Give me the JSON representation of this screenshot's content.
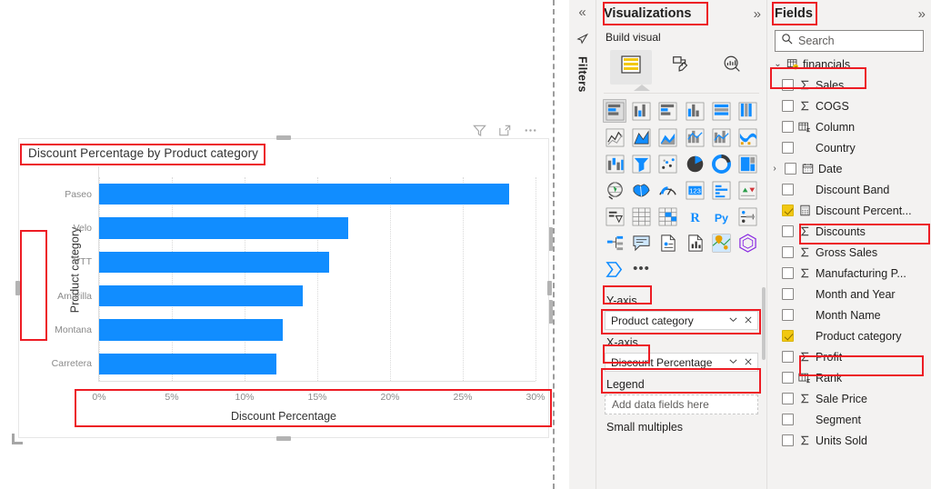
{
  "canvas": {
    "visual_title": "Discount Percentage by Product category",
    "header_icons": [
      {
        "name": "filter-icon",
        "label": "Filters"
      },
      {
        "name": "focus-mode-icon",
        "label": "Focus mode"
      },
      {
        "name": "more-options-icon",
        "label": "More options"
      }
    ]
  },
  "chart_data": {
    "type": "bar",
    "orientation": "horizontal",
    "title": "Discount Percentage by Product category",
    "xlabel": "Discount Percentage",
    "ylabel": "Product category",
    "categories": [
      "Paseo",
      "Velo",
      "VTT",
      "Amarilla",
      "Montana",
      "Carretera"
    ],
    "values": [
      28.2,
      17.1,
      15.8,
      14.0,
      12.6,
      12.2
    ],
    "value_format": "percent",
    "xlim": [
      0,
      30
    ],
    "xticks": [
      0,
      5,
      10,
      15,
      20,
      25,
      30
    ],
    "xtick_labels": [
      "0%",
      "5%",
      "10%",
      "15%",
      "20%",
      "25%",
      "30%"
    ],
    "grid": true,
    "legend": false,
    "series_color": "#118DFF"
  },
  "filters_rail": {
    "collapse_chevron": "«",
    "icon": "filter-funnel-icon",
    "label": "Filters"
  },
  "visualizations": {
    "title": "Visualizations",
    "expand_chevron": "»",
    "build_visual_label": "Build visual",
    "tabs": [
      {
        "name": "build-visual-tab",
        "icon": "fields-build-icon",
        "active": true
      },
      {
        "name": "format-visual-tab",
        "icon": "paint-roller-icon",
        "active": false
      },
      {
        "name": "analytics-tab",
        "icon": "magnifier-chart-icon",
        "active": false
      }
    ],
    "visual_types": [
      {
        "name": "stacked-bar-chart",
        "selected": true
      },
      {
        "name": "stacked-column-chart",
        "selected": false
      },
      {
        "name": "clustered-bar-chart",
        "selected": false
      },
      {
        "name": "clustered-column-chart",
        "selected": false
      },
      {
        "name": "100-stacked-bar-chart",
        "selected": false
      },
      {
        "name": "100-stacked-column-chart",
        "selected": false
      },
      {
        "name": "line-chart",
        "selected": false
      },
      {
        "name": "area-chart",
        "selected": false
      },
      {
        "name": "stacked-area-chart",
        "selected": false
      },
      {
        "name": "line-and-stacked-column-chart",
        "selected": false
      },
      {
        "name": "line-and-clustered-column-chart",
        "selected": false
      },
      {
        "name": "ribbon-chart",
        "selected": false
      },
      {
        "name": "waterfall-chart",
        "selected": false
      },
      {
        "name": "funnel-chart",
        "selected": false
      },
      {
        "name": "scatter-chart",
        "selected": false
      },
      {
        "name": "pie-chart",
        "selected": false
      },
      {
        "name": "donut-chart",
        "selected": false
      },
      {
        "name": "treemap",
        "selected": false
      },
      {
        "name": "map",
        "selected": false
      },
      {
        "name": "filled-map",
        "selected": false
      },
      {
        "name": "gauge",
        "selected": false
      },
      {
        "name": "card",
        "selected": false
      },
      {
        "name": "multi-row-card",
        "selected": false
      },
      {
        "name": "kpi",
        "selected": false
      },
      {
        "name": "slicer",
        "selected": false
      },
      {
        "name": "table",
        "selected": false
      },
      {
        "name": "matrix",
        "selected": false
      },
      {
        "name": "r-script-visual",
        "selected": false
      },
      {
        "name": "python-visual",
        "selected": false
      },
      {
        "name": "key-influencers",
        "selected": false
      },
      {
        "name": "decomposition-tree",
        "selected": false
      },
      {
        "name": "q-and-a",
        "selected": false
      },
      {
        "name": "smart-narrative",
        "selected": false
      },
      {
        "name": "paginated-report",
        "selected": false
      },
      {
        "name": "azure-map",
        "selected": false
      },
      {
        "name": "power-apps",
        "selected": false
      },
      {
        "name": "power-automate",
        "selected": false
      },
      {
        "name": "more-visuals",
        "selected": false
      }
    ],
    "wells": [
      {
        "label": "Y-axis",
        "field": "Product category",
        "placeholder": null
      },
      {
        "label": "X-axis",
        "field": "Discount Percentage",
        "placeholder": null
      },
      {
        "label": "Legend",
        "field": null,
        "placeholder": "Add data fields here"
      },
      {
        "label": "Small multiples",
        "field": null,
        "placeholder": null
      }
    ],
    "chip_dropdown_icon": "chevron-down-icon",
    "chip_remove_icon": "close-icon"
  },
  "fields": {
    "title": "Fields",
    "expand_chevron": "»",
    "search_placeholder": "Search",
    "search_value": "",
    "search_icon": "search-icon",
    "table": {
      "name": "financials",
      "expanded": true,
      "caret": "⌄",
      "icon": "table-warning-icon"
    },
    "items": [
      {
        "label": "Sales",
        "icon": "sigma-icon",
        "checked": false,
        "expandable": false
      },
      {
        "label": "COGS",
        "icon": "sigma-icon",
        "checked": false,
        "expandable": false
      },
      {
        "label": "Column",
        "icon": "calculated-column-icon",
        "checked": false,
        "expandable": false
      },
      {
        "label": "Country",
        "icon": "none",
        "checked": false,
        "expandable": false
      },
      {
        "label": "Date",
        "icon": "calendar-icon",
        "checked": false,
        "expandable": true
      },
      {
        "label": "Discount Band",
        "icon": "none",
        "checked": false,
        "expandable": false
      },
      {
        "label": "Discount Percent...",
        "icon": "measure-icon",
        "checked": true,
        "expandable": false
      },
      {
        "label": "Discounts",
        "icon": "sigma-icon",
        "checked": false,
        "expandable": false
      },
      {
        "label": "Gross Sales",
        "icon": "sigma-icon",
        "checked": false,
        "expandable": false
      },
      {
        "label": "Manufacturing P...",
        "icon": "sigma-icon",
        "checked": false,
        "expandable": false
      },
      {
        "label": "Month and Year",
        "icon": "none",
        "checked": false,
        "expandable": false
      },
      {
        "label": "Month Name",
        "icon": "none",
        "checked": false,
        "expandable": false
      },
      {
        "label": "Product category",
        "icon": "none",
        "checked": true,
        "expandable": false
      },
      {
        "label": "Profit",
        "icon": "sigma-icon",
        "checked": false,
        "expandable": false
      },
      {
        "label": "Rank",
        "icon": "calculated-column-icon",
        "checked": false,
        "expandable": false
      },
      {
        "label": "Sale Price",
        "icon": "sigma-icon",
        "checked": false,
        "expandable": false
      },
      {
        "label": "Segment",
        "icon": "none",
        "checked": false,
        "expandable": false
      },
      {
        "label": "Units Sold",
        "icon": "sigma-icon",
        "checked": false,
        "expandable": false
      }
    ]
  },
  "annotations": {
    "color": "#ED1C24",
    "boxes": [
      {
        "name": "annotation-visual-title"
      },
      {
        "name": "annotation-y-axis-title"
      },
      {
        "name": "annotation-x-axis"
      },
      {
        "name": "annotation-visualizations-header"
      },
      {
        "name": "annotation-y-axis-well-label"
      },
      {
        "name": "annotation-y-axis-well-chip"
      },
      {
        "name": "annotation-x-axis-well-label"
      },
      {
        "name": "annotation-x-axis-well-chip"
      },
      {
        "name": "annotation-fields-header"
      },
      {
        "name": "annotation-financials-table"
      },
      {
        "name": "annotation-discount-percentage-field"
      },
      {
        "name": "annotation-product-category-field"
      }
    ]
  }
}
